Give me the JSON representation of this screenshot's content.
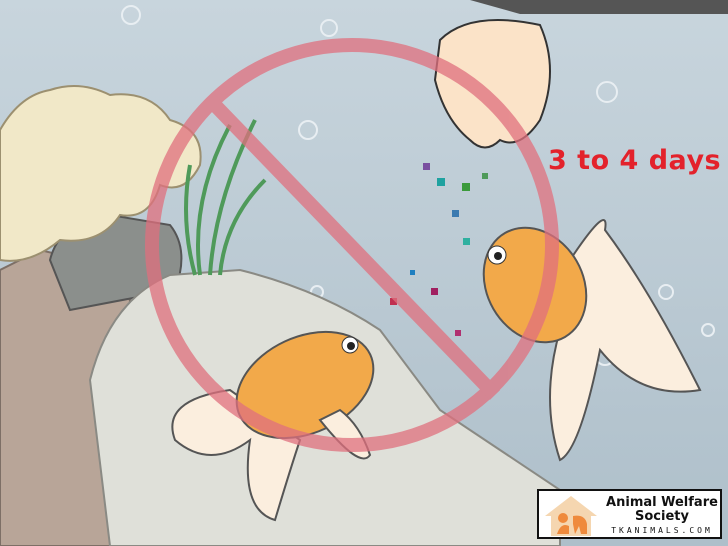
{
  "caption": "3 to 4 days",
  "logo": {
    "name": "Animal Welfare Society",
    "site": "TKANIMALS.COM"
  },
  "colors": {
    "background": "#bccbd4",
    "prohibition": "#e0707e",
    "caption": "#e3222b",
    "fish": "#f2a94a",
    "logo_house": "#f5d6b0",
    "logo_animals": "#ef8a3c"
  },
  "icons": [
    "prohibition-sign",
    "hand",
    "goldfish",
    "coral",
    "seaweed",
    "rocks",
    "bubbles",
    "fish-food",
    "house-logo"
  ]
}
